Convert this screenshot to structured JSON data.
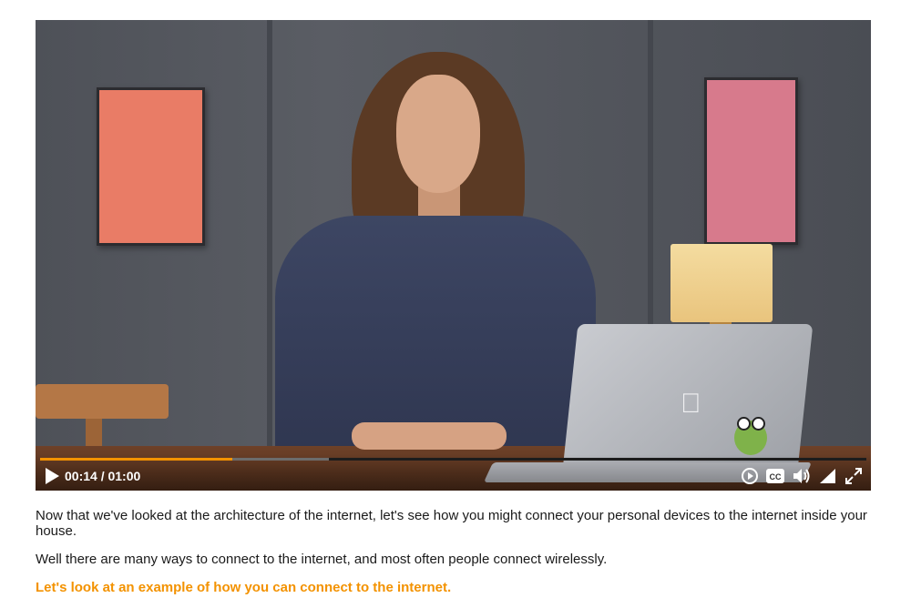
{
  "player": {
    "time_current": "00:14",
    "time_separator": "/",
    "time_total": "01:00",
    "progress_fraction": 0.233,
    "buffered_fraction": 0.35,
    "accent_color": "#f39200",
    "icons": [
      "play-icon",
      "replay-icon",
      "closed-captions-icon",
      "volume-icon",
      "quality-icon",
      "fullscreen-icon"
    ],
    "cc_label": "CC"
  },
  "transcript": {
    "lines": [
      "Now that we've looked at the architecture of the internet, let's see how you might connect your personal devices to the internet inside your house.",
      "Well there are many ways to connect to the internet, and most often people connect wirelessly.",
      "Let's look at an example of how you can connect to the internet."
    ],
    "highlight_color": "#f39200"
  }
}
